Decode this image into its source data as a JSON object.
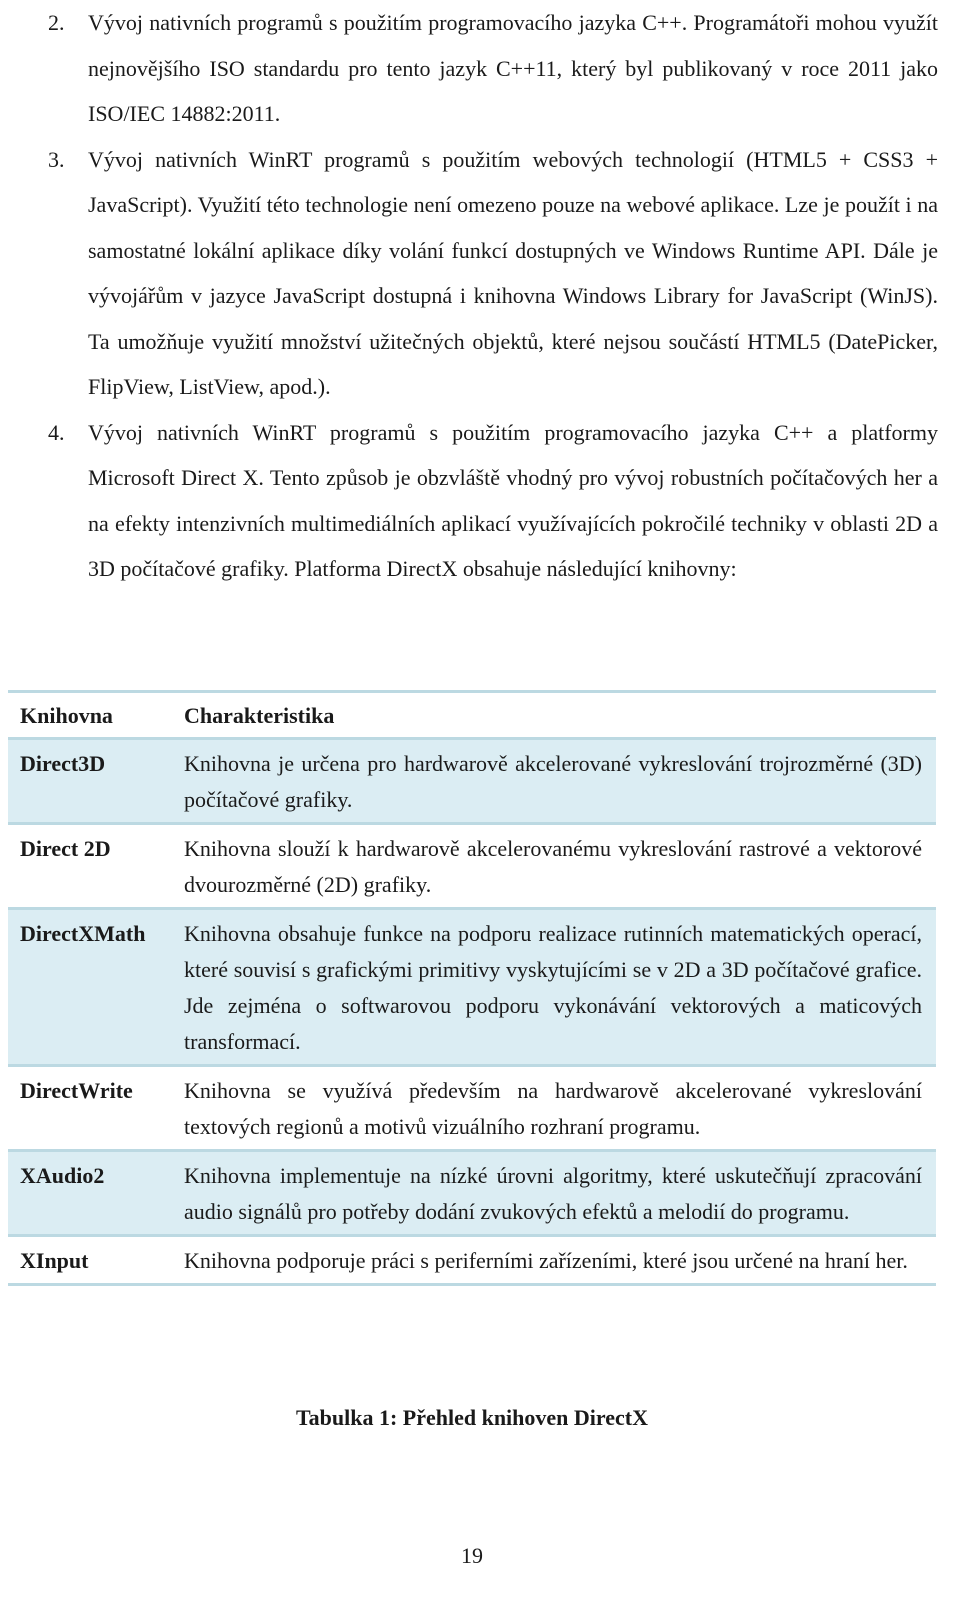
{
  "list": [
    {
      "number": "2.",
      "text": "Vývoj nativních programů s použitím programovacího jazyka C++. Programátoři mohou využít nejnovějšího ISO standardu pro tento jazyk C++11, který byl publikovaný v roce 2011 jako ISO/IEC 14882:2011."
    },
    {
      "number": "3.",
      "text": "Vývoj nativních WinRT programů s použitím webových technologií (HTML5 + CSS3 + JavaScript). Využití této technologie není omezeno pouze na webové aplikace. Lze je použít i na samostatné lokální aplikace díky volání funkcí dostupných ve Windows Runtime API. Dále je vývojářům v jazyce JavaScript dostupná i knihovna Windows Library for JavaScript (WinJS). Ta umožňuje využití množství užitečných objektů, které nejsou součástí HTML5 (DatePicker, FlipView, ListView, apod.)."
    },
    {
      "number": "4.",
      "text": "Vývoj nativních WinRT programů s použitím programovacího jazyka C++ a platformy Microsoft Direct X. Tento způsob je obzvláště vhodný pro vývoj robustních počítačových her a na efekty intenzivních multimediálních aplikací využívajících pokročilé techniky v oblasti 2D a 3D počítačové grafiky. Platforma DirectX obsahuje následující knihovny:"
    }
  ],
  "table": {
    "headers": [
      "Knihovna",
      "Charakteristika"
    ],
    "rows": [
      {
        "library": "Direct3D",
        "description": "Knihovna je určena pro hardwarově akcelerované vykreslování trojrozměrné (3D) počítačové grafiky."
      },
      {
        "library": "Direct 2D",
        "description": "Knihovna slouží k hardwarově akcelerovanému vykreslování rastrové a vektorové dvourozměrné (2D) grafiky."
      },
      {
        "library": "DirectXMath",
        "description": "Knihovna obsahuje funkce na podporu realizace rutinních matematických operací, které souvisí s grafickými primitivy vyskytujícími se v 2D a 3D počítačové grafice. Jde zejména o softwarovou podporu vykonávání vektorových a maticových transformací."
      },
      {
        "library": "DirectWrite",
        "description": "Knihovna se využívá především na hardwarově akcelerované vykreslování textových regionů a motivů vizuálního rozhraní programu."
      },
      {
        "library": "XAudio2",
        "description": "Knihovna implementuje na nízké úrovni algoritmy, které uskutečňují zpracování audio signálů pro potřeby dodání zvukových efektů a melodií do programu."
      },
      {
        "library": "XInput",
        "description": "Knihovna podporuje práci s periferními zařízeními, které jsou určené na hraní her."
      }
    ],
    "colors": {
      "shade": "#dbedf3",
      "rule": "#bcd9e2"
    }
  },
  "caption": "Tabulka 1: Přehled knihoven DirectX",
  "page_number": "19"
}
